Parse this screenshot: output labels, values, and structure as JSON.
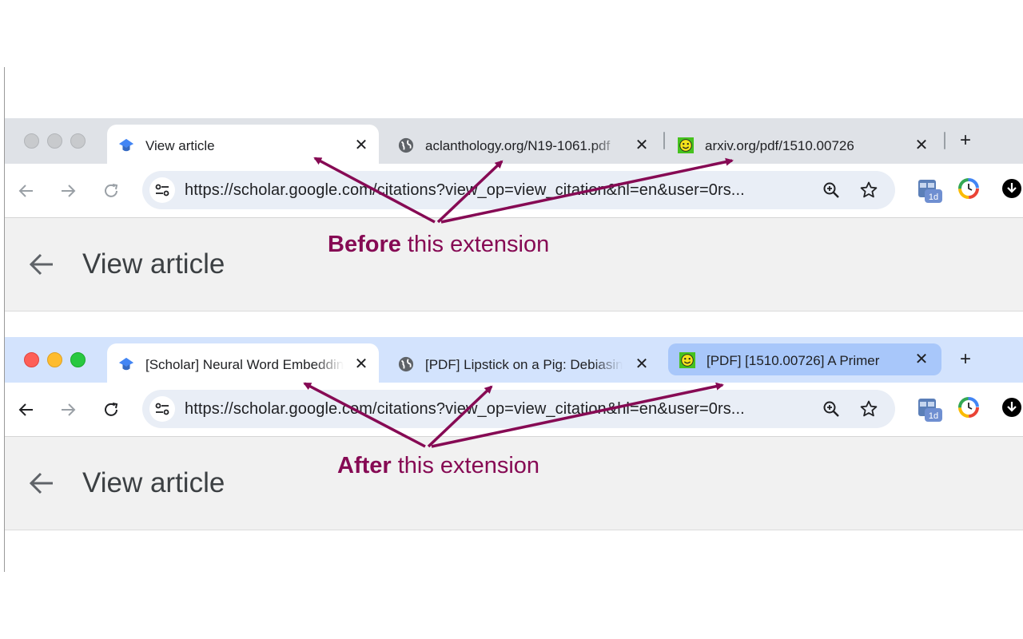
{
  "before": {
    "label_bold": "Before",
    "label_rest": " this extension",
    "tabs": [
      {
        "title": "View article",
        "favicon": "scholar-icon",
        "state": "active"
      },
      {
        "title": "aclanthology.org/N19-1061.pdf",
        "favicon": "globe-icon",
        "state": "inactive"
      },
      {
        "title": "arxiv.org/pdf/1510.00726",
        "favicon": "smiley-icon",
        "state": "inactive"
      }
    ],
    "url": "https://scholar.google.com/citations?view_op=view_citation&hl=en&user=0rs...",
    "page_title": "View article"
  },
  "after": {
    "label_bold": "After",
    "label_rest": " this extension",
    "tabs": [
      {
        "title": "[Scholar] Neural Word Embeddings",
        "favicon": "scholar-icon",
        "state": "active"
      },
      {
        "title": "[PDF] Lipstick on a Pig: Debiasing",
        "favicon": "globe-icon",
        "state": "inactive"
      },
      {
        "title": "[PDF] [1510.00726] A Primer",
        "favicon": "smiley-icon",
        "state": "highlighted"
      }
    ],
    "url": "https://scholar.google.com/citations?view_op=view_citation&hl=en&user=0rs...",
    "page_title": "View article"
  },
  "extension_badge": "1d",
  "colors": {
    "annotation": "#860a54",
    "tabstrip_before": "#dfe2e7",
    "tabstrip_after": "#d3e3fd",
    "highlight_tab": "#a8c7fa"
  }
}
